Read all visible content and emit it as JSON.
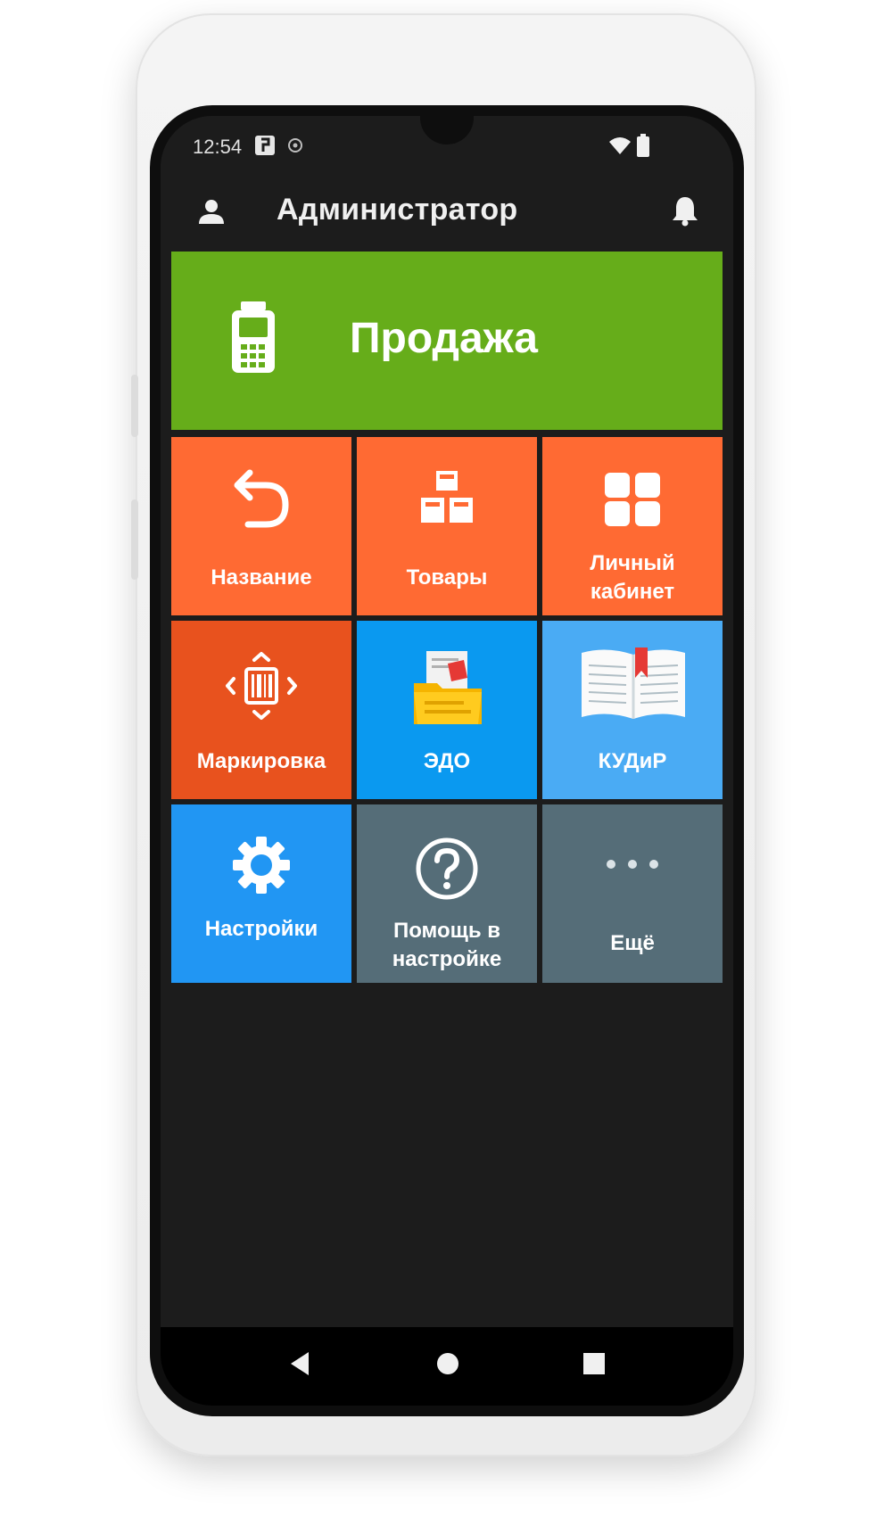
{
  "status_bar": {
    "time": "12:54"
  },
  "app_bar": {
    "title": "Администратор"
  },
  "main_tile": {
    "label": "Продажа",
    "color": "#66ad1a"
  },
  "tiles": [
    {
      "label": "Название",
      "icon": "undo-arrow-icon",
      "color": "#ff6a33"
    },
    {
      "label": "Товары",
      "icon": "boxes-icon",
      "color": "#ff6a33"
    },
    {
      "label": "Личный кабинет",
      "icon": "dashboard-grid-icon",
      "color": "#ff6a33"
    },
    {
      "label": "Маркировка",
      "icon": "barcode-scan-icon",
      "color": "#e8521e"
    },
    {
      "label": "ЭДО",
      "icon": "document-folder-icon",
      "color": "#0a99f0"
    },
    {
      "label": "КУДиР",
      "icon": "open-book-icon",
      "color": "#4aabf4"
    },
    {
      "label": "Настройки",
      "icon": "gear-icon",
      "color": "#2196f3"
    },
    {
      "label": "Помощь в настройке",
      "icon": "help-circle-icon",
      "color": "#556d78"
    },
    {
      "label": "Ещё",
      "icon": "more-dots-icon",
      "color": "#556d78"
    }
  ]
}
